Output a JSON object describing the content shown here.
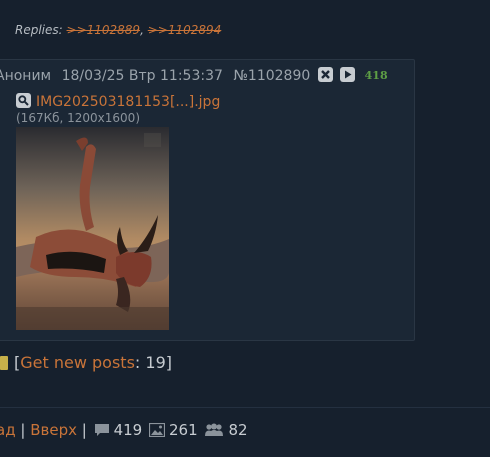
{
  "replies": {
    "label": "Replies:",
    "links": [
      ">>1102889",
      ">>1102894"
    ],
    "separator": ","
  },
  "post": {
    "author": "Аноним",
    "date": "18/03/25",
    "weekday": "Втр",
    "time": "11:53:37",
    "number": "№1102890",
    "reply_count": "418",
    "file": {
      "name": "IMG202503181153[...].jpg",
      "meta": "(167Кб, 1200x1600)"
    }
  },
  "thread_nav": {
    "open_bracket": "[",
    "get_new_label": "Get new posts",
    "colon": ":",
    "new_count": "19",
    "close_bracket": "]"
  },
  "footer": {
    "back_label": "ад",
    "sep1": "|",
    "up_label": "Вверх",
    "sep2": "|",
    "posts_count": "419",
    "images_count": "261",
    "users_count": "82"
  },
  "colors": {
    "background": "#16202d",
    "post_bg": "#1b2735",
    "link": "#c97439",
    "counter_green": "#5e9f45"
  }
}
